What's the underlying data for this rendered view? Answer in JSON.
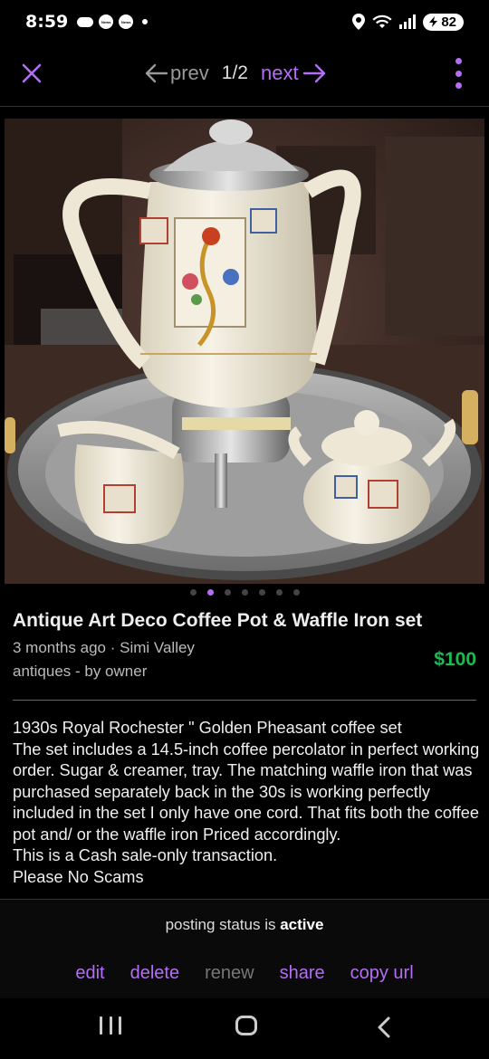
{
  "status_bar": {
    "time": "8:59",
    "news_label": "News",
    "battery": "82",
    "icons": [
      "cloud-icon",
      "news-icon",
      "news-icon",
      "dot-icon",
      "location-icon",
      "wifi-icon",
      "signal-icon",
      "battery-icon"
    ]
  },
  "nav": {
    "prev_label": "prev",
    "counter": "1/2",
    "next_label": "next",
    "accent_color": "#b46ef5"
  },
  "photo": {
    "dots_total": 7,
    "dots_active_index": 1
  },
  "listing": {
    "title": "Antique Art Deco Coffee Pot & Waffle Iron set",
    "posted": "3 months ago · Simi Valley",
    "category": "antiques - by owner",
    "price": "$100",
    "description_lines": [
      "1930s Royal Rochester \" Golden Pheasant coffee set",
      "The set includes a 14.5-inch coffee percolator in perfect working order. Sugar & creamer, tray. The matching waffle iron that was purchased separately back in the 30s is working perfectly included in the set I only have one cord. That fits both the coffee pot and/ or the waffle iron Priced accordingly.",
      "This is a Cash sale-only transaction.",
      "Please No Scams"
    ]
  },
  "footer": {
    "status_prefix": "posting status is",
    "status_value": "active",
    "actions": {
      "edit": "edit",
      "delete": "delete",
      "renew": "renew",
      "share": "share",
      "copy_url": "copy url"
    }
  }
}
